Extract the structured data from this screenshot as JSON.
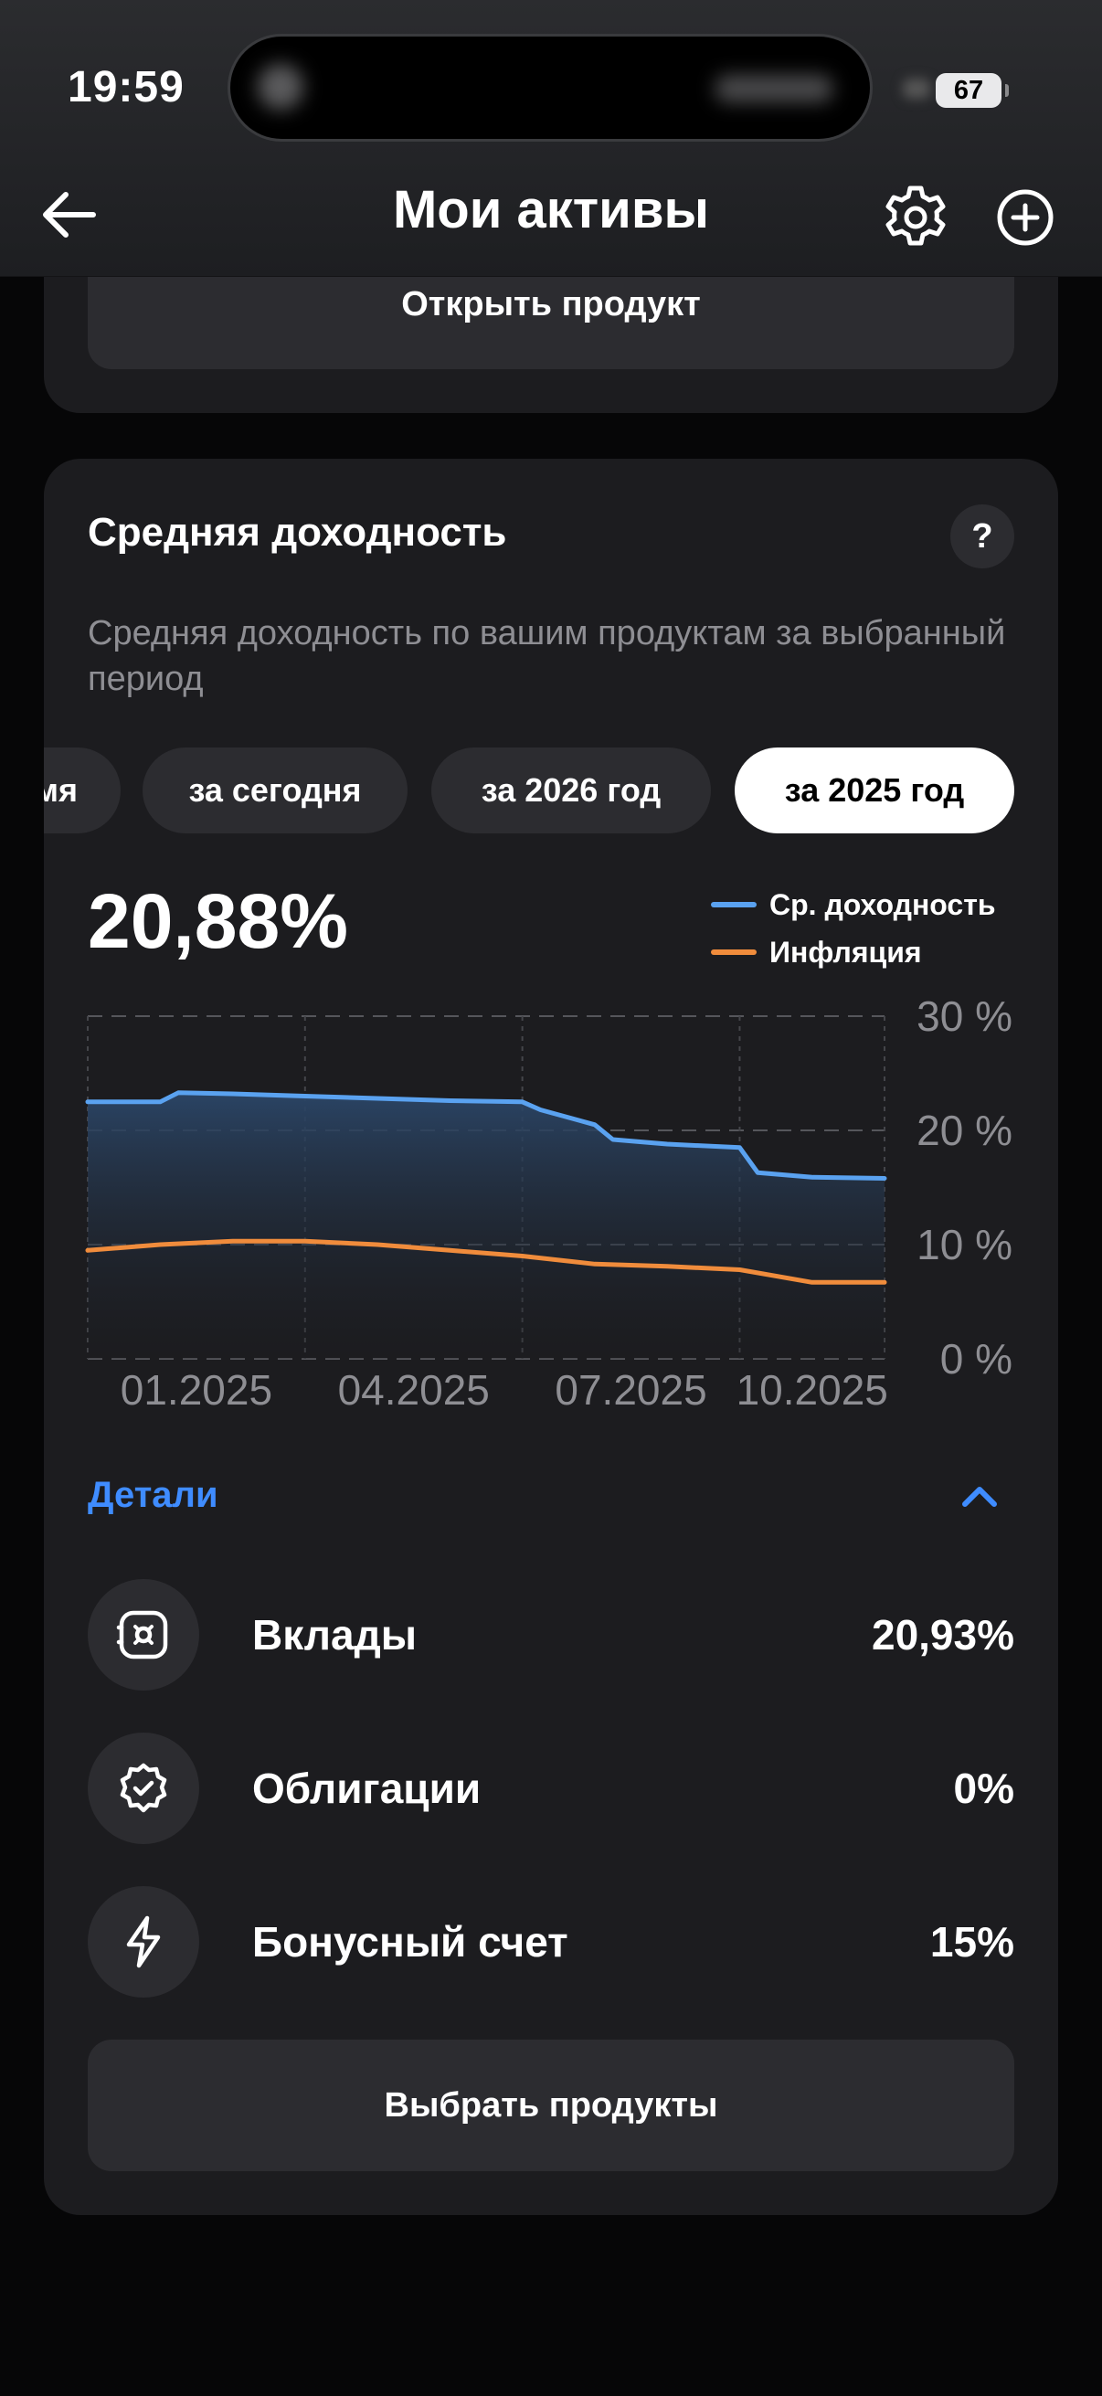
{
  "status": {
    "time": "19:59",
    "battery": "67"
  },
  "nav": {
    "title": "Мои активы"
  },
  "top_card": {
    "button_label": "Открыть продукт"
  },
  "main": {
    "title": "Средняя доходность",
    "help": "?",
    "subtitle": "Средняя доходность по вашим продуктам за выбранный период",
    "periods": [
      {
        "label": "за всё время",
        "active": false
      },
      {
        "label": "за сегодня",
        "active": false
      },
      {
        "label": "за 2026 год",
        "active": false
      },
      {
        "label": "за 2025 год",
        "active": true
      }
    ],
    "value": "20,88%",
    "legend": [
      {
        "label": "Ср. доходность",
        "color": "#5aa2f0"
      },
      {
        "label": "Инфляция",
        "color": "#f08c3c"
      }
    ],
    "details_label": "Детали",
    "assets": [
      {
        "name": "Вклады",
        "value": "20,93%",
        "icon": "safe-icon"
      },
      {
        "name": "Облигации",
        "value": "0%",
        "icon": "badge-check-icon"
      },
      {
        "name": "Бонусный счет",
        "value": "15%",
        "icon": "lightning-icon"
      }
    ],
    "select_button": "Выбрать продукты"
  },
  "chart_data": {
    "type": "area",
    "y_ticks": [
      "30 %",
      "20 %",
      "10 %",
      "0 %"
    ],
    "ylim": [
      0,
      30
    ],
    "x_ticks": [
      "01.2025",
      "04.2025",
      "07.2025",
      "10.2025"
    ],
    "grid": true,
    "series": [
      {
        "name": "Ср. доходность",
        "color": "#5aa2f0",
        "x": [
          "01.2025",
          "02.2025",
          "02.2025",
          "03.2025",
          "04.2025",
          "05.2025",
          "06.2025",
          "07.2025",
          "07.2025",
          "08.2025",
          "08.2025",
          "09.2025",
          "10.2025",
          "10.2025",
          "11.2025",
          "12.2025"
        ],
        "values": [
          22.5,
          22.5,
          23.3,
          23.2,
          23.0,
          22.8,
          22.6,
          22.5,
          21.8,
          20.5,
          19.2,
          18.8,
          18.5,
          16.3,
          15.9,
          15.8
        ]
      },
      {
        "name": "Инфляция",
        "color": "#f08c3c",
        "x": [
          "01.2025",
          "02.2025",
          "03.2025",
          "04.2025",
          "05.2025",
          "06.2025",
          "07.2025",
          "08.2025",
          "09.2025",
          "10.2025",
          "11.2025",
          "12.2025"
        ],
        "values": [
          9.5,
          10.0,
          10.3,
          10.3,
          10.0,
          9.5,
          9.0,
          8.3,
          8.1,
          7.8,
          6.7,
          6.7
        ]
      }
    ]
  }
}
